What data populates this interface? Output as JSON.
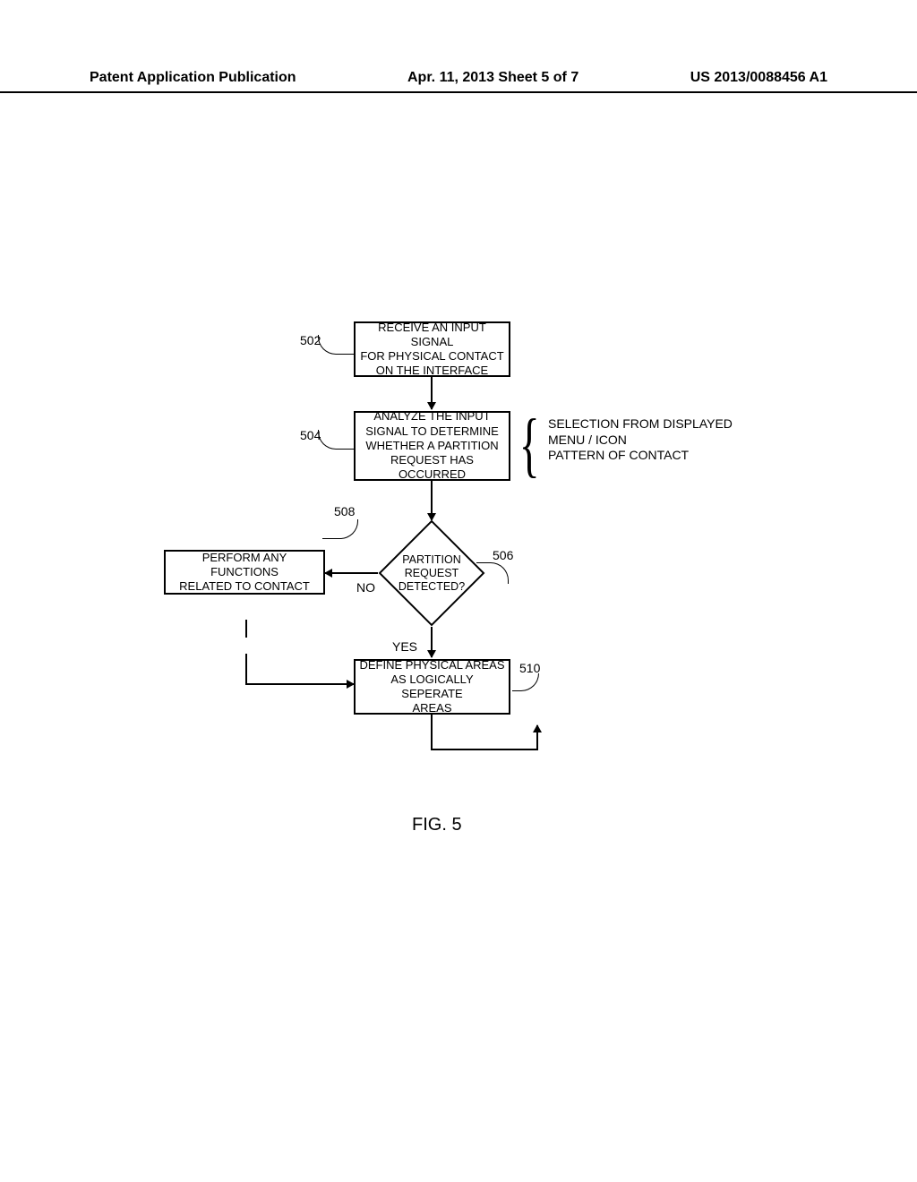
{
  "header": {
    "left": "Patent Application Publication",
    "center": "Apr. 11, 2013  Sheet 5 of 7",
    "right": "US 2013/0088456 A1"
  },
  "refs": {
    "r502": "502",
    "r504": "504",
    "r506": "506",
    "r508": "508",
    "r510": "510"
  },
  "blocks": {
    "b502": "RECEIVE AN INPUT SIGNAL\nFOR PHYSICAL CONTACT\nON THE INTERFACE",
    "b504": "ANALYZE THE INPUT\nSIGNAL TO DETERMINE\nWHETHER A PARTITION\nREQUEST HAS OCCURRED",
    "b506": "PARTITION\nREQUEST\nDETECTED?",
    "b508": "PERFORM ANY FUNCTIONS\nRELATED TO CONTACT",
    "b510": "DEFINE PHYSICAL AREAS\nAS LOGICALLY SEPERATE\nAREAS"
  },
  "annotations": {
    "side504": "SELECTION FROM DISPLAYED\nMENU / ICON\nPATTERN OF CONTACT",
    "no": "NO",
    "yes": "YES"
  },
  "figure_label": "FIG. 5"
}
